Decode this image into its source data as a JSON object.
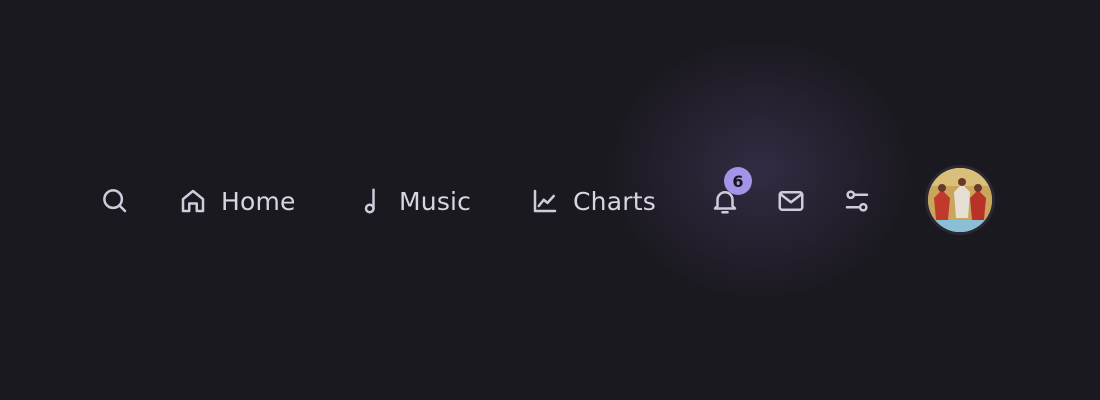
{
  "nav": {
    "items": [
      {
        "label": "Home",
        "icon": "home-icon"
      },
      {
        "label": "Music",
        "icon": "music-note-icon"
      },
      {
        "label": "Charts",
        "icon": "line-chart-icon"
      }
    ],
    "search_icon": "search-icon",
    "notifications": {
      "icon": "bell-icon",
      "count": "6"
    },
    "mail_icon": "mail-icon",
    "settings_icon": "sliders-icon",
    "avatar": "user-avatar"
  },
  "colors": {
    "background": "#1b1920",
    "glow": "#463a60",
    "text": "#d8d5e2",
    "icon": "#cfcbdc",
    "badge": "#a493e6"
  }
}
